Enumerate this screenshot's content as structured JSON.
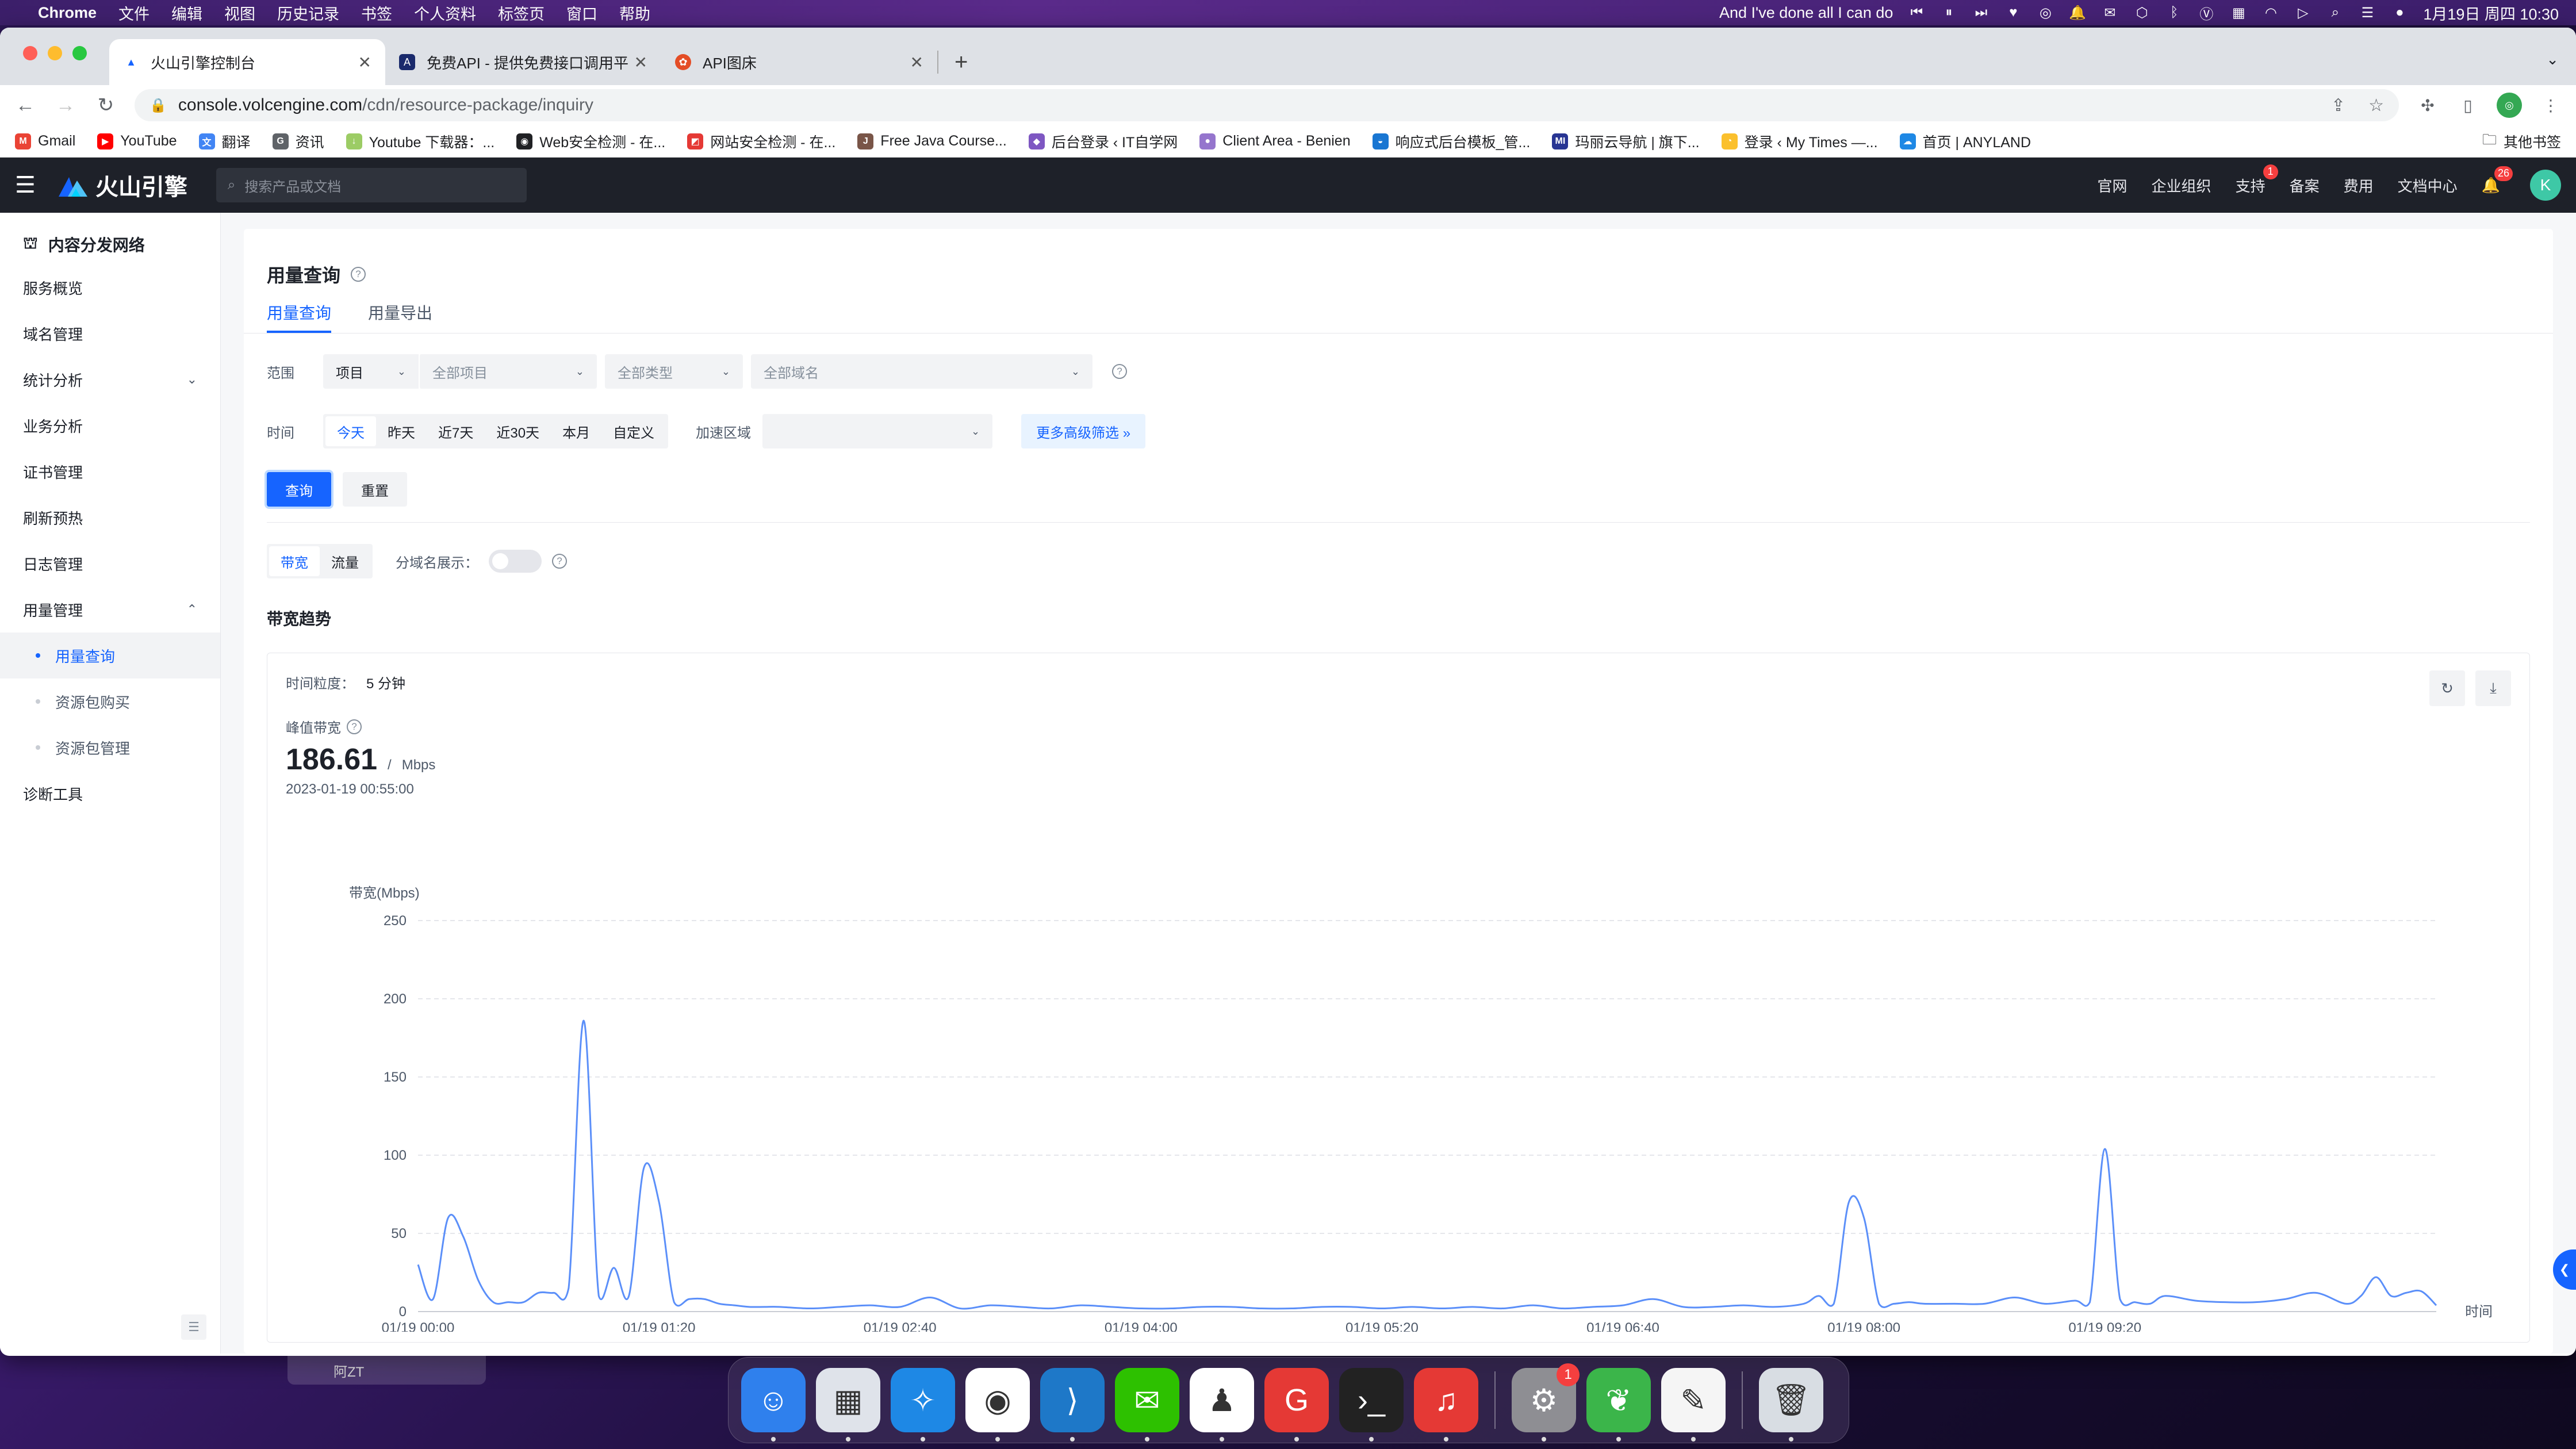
{
  "menubar": {
    "app": "Chrome",
    "items": [
      "文件",
      "编辑",
      "视图",
      "历史记录",
      "书签",
      "个人资料",
      "标签页",
      "窗口",
      "帮助"
    ],
    "now_playing": "And I've done all I can do",
    "datetime": "1月19日 周四 10:30"
  },
  "tabs": [
    {
      "title": "火山引擎控制台",
      "fav_color": "#1664ff"
    },
    {
      "title": "免费API - 提供免费接口调用平台",
      "fav_color": "#1a2a6c"
    },
    {
      "title": "API图床",
      "fav_color": "#e44d26"
    }
  ],
  "omnibox": {
    "host": "console.volcengine.com",
    "path": "/cdn/resource-package/inquiry"
  },
  "bookmarks": [
    {
      "label": "Gmail",
      "color": "#ea4335",
      "glyph": "M"
    },
    {
      "label": "YouTube",
      "color": "#ff0000",
      "glyph": "▶"
    },
    {
      "label": "翻译",
      "color": "#4285f4",
      "glyph": "文"
    },
    {
      "label": "资讯",
      "color": "#5f6368",
      "glyph": "G"
    },
    {
      "label": "Youtube 下载器：...",
      "color": "#9ccc65",
      "glyph": "↓"
    },
    {
      "label": "Web安全检测 - 在...",
      "color": "#202124",
      "glyph": "◉"
    },
    {
      "label": "网站安全检测 - 在...",
      "color": "#e53935",
      "glyph": "◩"
    },
    {
      "label": "Free Java Course...",
      "color": "#795548",
      "glyph": "J"
    },
    {
      "label": "后台登录 ‹ IT自学网",
      "color": "#7e57c2",
      "glyph": "◆"
    },
    {
      "label": "Client Area - Benien",
      "color": "#9575cd",
      "glyph": "●"
    },
    {
      "label": "响应式后台模板_管...",
      "color": "#1976d2",
      "glyph": "◒"
    },
    {
      "label": "玛丽云导航 | 旗下...",
      "color": "#283593",
      "glyph": "MI"
    },
    {
      "label": "登录 ‹ My Times —...",
      "color": "#fbc02d",
      "glyph": "◔"
    },
    {
      "label": "首页 | ANYLAND",
      "color": "#1e88e5",
      "glyph": "☁"
    }
  ],
  "bookmarks_other": "其他书签",
  "header": {
    "brand": "火山引擎",
    "search_placeholder": "搜索产品或文档",
    "links": [
      "官网",
      "企业组织",
      "支持",
      "备案",
      "费用",
      "文档中心"
    ],
    "support_badge": "1",
    "bell_badge": "26",
    "avatar": "K"
  },
  "sidebar": {
    "title": "内容分发网络",
    "items": [
      {
        "label": "服务概览"
      },
      {
        "label": "域名管理"
      },
      {
        "label": "统计分析",
        "caret": "⌄"
      },
      {
        "label": "业务分析"
      },
      {
        "label": "证书管理"
      },
      {
        "label": "刷新预热"
      },
      {
        "label": "日志管理"
      },
      {
        "label": "用量管理",
        "caret": "⌃"
      }
    ],
    "sub_items": [
      "用量查询",
      "资源包购买",
      "资源包管理"
    ],
    "last_item": "诊断工具"
  },
  "page": {
    "title": "用量查询",
    "tabs": [
      "用量查询",
      "用量导出"
    ],
    "scope_label": "范围",
    "scope_type": "项目",
    "scope_project_placeholder": "全部项目",
    "scope_kind_placeholder": "全部类型",
    "scope_domain_placeholder": "全部域名",
    "time_label": "时间",
    "time_options": [
      "今天",
      "昨天",
      "近7天",
      "近30天",
      "本月",
      "自定义"
    ],
    "region_label": "加速区域",
    "more_filters": "更多高级筛选 »",
    "query_btn": "查询",
    "reset_btn": "重置",
    "metric_options": [
      "带宽",
      "流量"
    ],
    "split_label": "分域名展示：",
    "section_title": "带宽趋势",
    "granularity_label": "时间粒度：",
    "granularity_value": "5 分钟",
    "peak_label": "峰值带宽",
    "peak_value": "186.61",
    "peak_sep": "/",
    "peak_unit": "Mbps",
    "peak_time": "2023-01-19 00:55:00"
  },
  "chart_data": {
    "type": "line",
    "ylabel": "带宽(Mbps)",
    "xlabel": "时间",
    "ylim": [
      0,
      250
    ],
    "yticks": [
      0,
      50,
      100,
      150,
      200,
      250
    ],
    "xticks": [
      "01/19 00:00",
      "01/19 01:20",
      "01/19 02:40",
      "01/19 04:00",
      "01/19 05:20",
      "01/19 06:40",
      "01/19 08:00",
      "01/19 09:20"
    ],
    "grid": true,
    "color": "#5b8ff9",
    "x_minutes": [
      0,
      5,
      10,
      15,
      20,
      25,
      30,
      35,
      40,
      45,
      50,
      55,
      60,
      65,
      70,
      75,
      80,
      85,
      90,
      95,
      100,
      105,
      110,
      115,
      120,
      130,
      140,
      150,
      160,
      170,
      180,
      190,
      200,
      210,
      220,
      230,
      240,
      250,
      260,
      270,
      280,
      290,
      300,
      310,
      320,
      330,
      340,
      350,
      360,
      370,
      380,
      390,
      400,
      410,
      420,
      430,
      440,
      450,
      460,
      465,
      470,
      475,
      480,
      485,
      490,
      495,
      500,
      510,
      520,
      530,
      540,
      550,
      555,
      560,
      565,
      570,
      575,
      580,
      590,
      600,
      610,
      620,
      630,
      640,
      645,
      650,
      655,
      660,
      665,
      670
    ],
    "values": [
      30,
      8,
      60,
      48,
      20,
      6,
      6,
      6,
      12,
      12,
      15,
      186,
      10,
      28,
      10,
      92,
      70,
      6,
      8,
      8,
      5,
      4,
      3,
      3,
      3,
      2,
      3,
      4,
      3,
      9,
      2,
      4,
      3,
      2,
      4,
      3,
      2,
      2,
      3,
      3,
      2,
      2,
      3,
      3,
      2,
      3,
      2,
      3,
      2,
      4,
      2,
      3,
      4,
      8,
      3,
      3,
      4,
      3,
      5,
      10,
      5,
      70,
      60,
      5,
      5,
      6,
      5,
      5,
      5,
      9,
      5,
      7,
      6,
      104,
      8,
      6,
      5,
      10,
      7,
      6,
      6,
      8,
      12,
      5,
      10,
      22,
      10,
      12,
      13,
      4
    ]
  },
  "dock": {
    "apps": [
      {
        "name": "finder-icon",
        "color": "#2f80ed",
        "glyph": "☺"
      },
      {
        "name": "launchpad-icon",
        "color": "#dfe3ea",
        "glyph": "▦"
      },
      {
        "name": "safari-icon",
        "color": "#1e88e5",
        "glyph": "✧"
      },
      {
        "name": "chrome-icon",
        "color": "#ffffff",
        "glyph": "◉"
      },
      {
        "name": "vscode-icon",
        "color": "#1e78c8",
        "glyph": "⟩"
      },
      {
        "name": "wechat-icon",
        "color": "#2dc100",
        "glyph": "✉"
      },
      {
        "name": "qq-icon",
        "color": "#ffffff",
        "glyph": "♟"
      },
      {
        "name": "foxmail-icon",
        "color": "#e53935",
        "glyph": "G"
      },
      {
        "name": "terminal-icon",
        "color": "#222222",
        "glyph": "›_"
      },
      {
        "name": "netease-music-icon",
        "color": "#e53935",
        "glyph": "♫"
      }
    ],
    "apps_right": [
      {
        "name": "system-settings-icon",
        "color": "#8e8e93",
        "glyph": "⚙",
        "badge": "1"
      },
      {
        "name": "navicat-icon",
        "color": "#3bb54a",
        "glyph": "❦"
      },
      {
        "name": "textedit-icon",
        "color": "#f5f5f5",
        "glyph": "✎"
      }
    ],
    "trash": {
      "name": "trash-icon",
      "color": "#d8dde3",
      "glyph": "🗑"
    }
  },
  "ghost_label": "阿ZT"
}
